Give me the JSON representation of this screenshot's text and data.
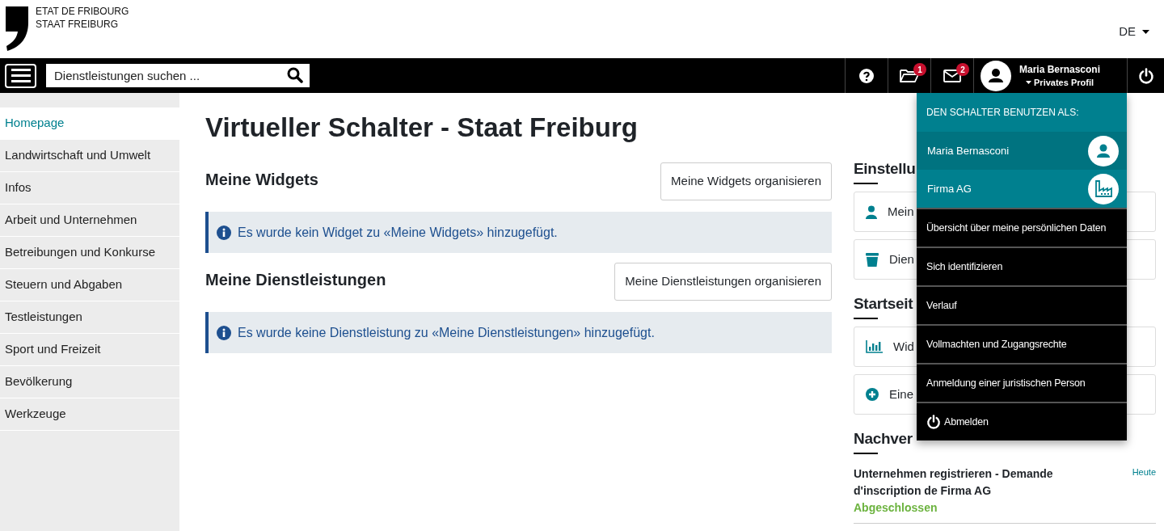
{
  "brand": {
    "line_1": "ETAT DE FRIBOURG",
    "line_2": "STAAT FREIBURG"
  },
  "language": "DE",
  "search": {
    "placeholder": "Dienstleistungen suchen ..."
  },
  "toolbar": {
    "folder_badge": "1",
    "mail_badge": "2",
    "user_name": "Maria Bernasconi",
    "profile": "Privates Profil"
  },
  "sidebar": {
    "items": [
      {
        "label": "Homepage",
        "selected": true
      },
      {
        "label": "Landwirtschaft und Umwelt",
        "selected": false
      },
      {
        "label": "Infos",
        "selected": false
      },
      {
        "label": "Arbeit und Unternehmen",
        "selected": false
      },
      {
        "label": "Betreibungen und Konkurse",
        "selected": false
      },
      {
        "label": "Steuern und Abgaben",
        "selected": false
      },
      {
        "label": "Testleistungen",
        "selected": false
      },
      {
        "label": "Sport und Freizeit",
        "selected": false
      },
      {
        "label": "Bevölkerung",
        "selected": false
      },
      {
        "label": "Werkzeuge",
        "selected": false
      }
    ]
  },
  "main": {
    "title": "Virtueller Schalter - Staat Freiburg",
    "sections": [
      {
        "heading": "Meine Widgets",
        "button": "Meine Widgets organisieren",
        "info": "Es wurde kein Widget zu «Meine Widgets» hinzugefügt."
      },
      {
        "heading": "Meine Dienstleistungen",
        "button": "Meine Dienstleistungen organisieren",
        "info": "Es wurde keine Dienstleistung zu «Meine Dienstleistungen» hinzugefügt."
      }
    ]
  },
  "right": {
    "groups": [
      {
        "heading": "Einstellu",
        "cards": [
          {
            "kind": "person",
            "label": "Mein"
          },
          {
            "kind": "bin",
            "label": "Dien"
          }
        ]
      },
      {
        "heading": "Startseit",
        "cards": [
          {
            "kind": "chart",
            "label": "Wid"
          },
          {
            "kind": "plus",
            "label": "Eine"
          }
        ]
      },
      {
        "heading": "Nachver"
      }
    ],
    "request": {
      "title": "Unternehmen registrieren - Demande d'inscription de Firma AG",
      "date": "Heute",
      "status": "Abgeschlossen"
    }
  },
  "menu": {
    "header": "DEN SCHALTER BENUTZEN ALS:",
    "profiles": [
      {
        "label": "Maria Bernasconi",
        "kind": "person",
        "selected": true
      },
      {
        "label": "Firma AG",
        "kind": "company",
        "selected": false
      }
    ],
    "items": [
      {
        "label": "Übersicht über meine persönlichen Daten",
        "kind": "link"
      },
      {
        "label": "Sich identifizieren",
        "kind": "link"
      },
      {
        "label": "Verlauf",
        "kind": "link"
      },
      {
        "label": "Vollmachten und Zugangsrechte",
        "kind": "link"
      },
      {
        "label": "Anmeldung einer juristischen Person",
        "kind": "link"
      },
      {
        "label": "Abmelden",
        "kind": "logout"
      }
    ]
  }
}
